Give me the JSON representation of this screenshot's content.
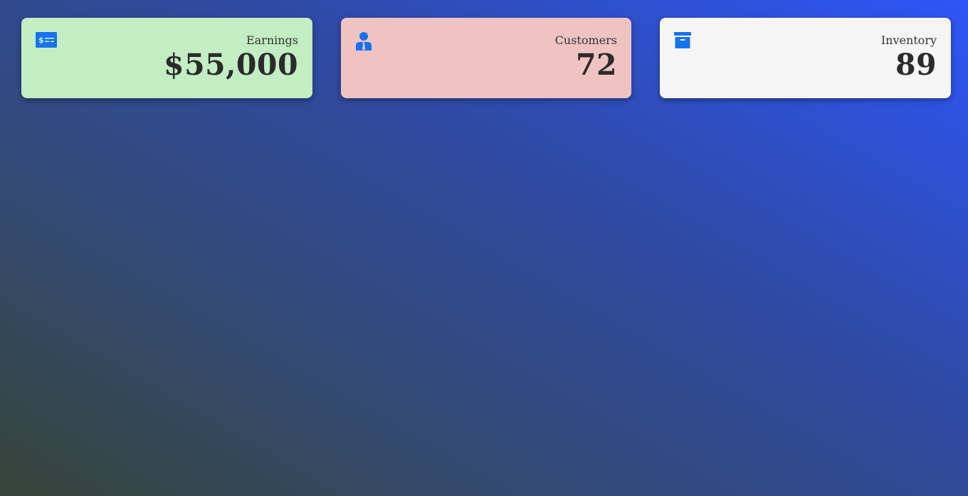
{
  "theme": {
    "accent": "#1673f0",
    "earnings_bg": "#c3edc3",
    "customers_bg": "#f0c3c3",
    "inventory_bg": "#f5f5f5"
  },
  "cards": [
    {
      "icon": "money-check-dollar-icon",
      "label": "Earnings",
      "value": "$55,000"
    },
    {
      "icon": "user-tie-icon",
      "label": "Customers",
      "value": "72"
    },
    {
      "icon": "archive-box-icon",
      "label": "Inventory",
      "value": "89"
    }
  ]
}
